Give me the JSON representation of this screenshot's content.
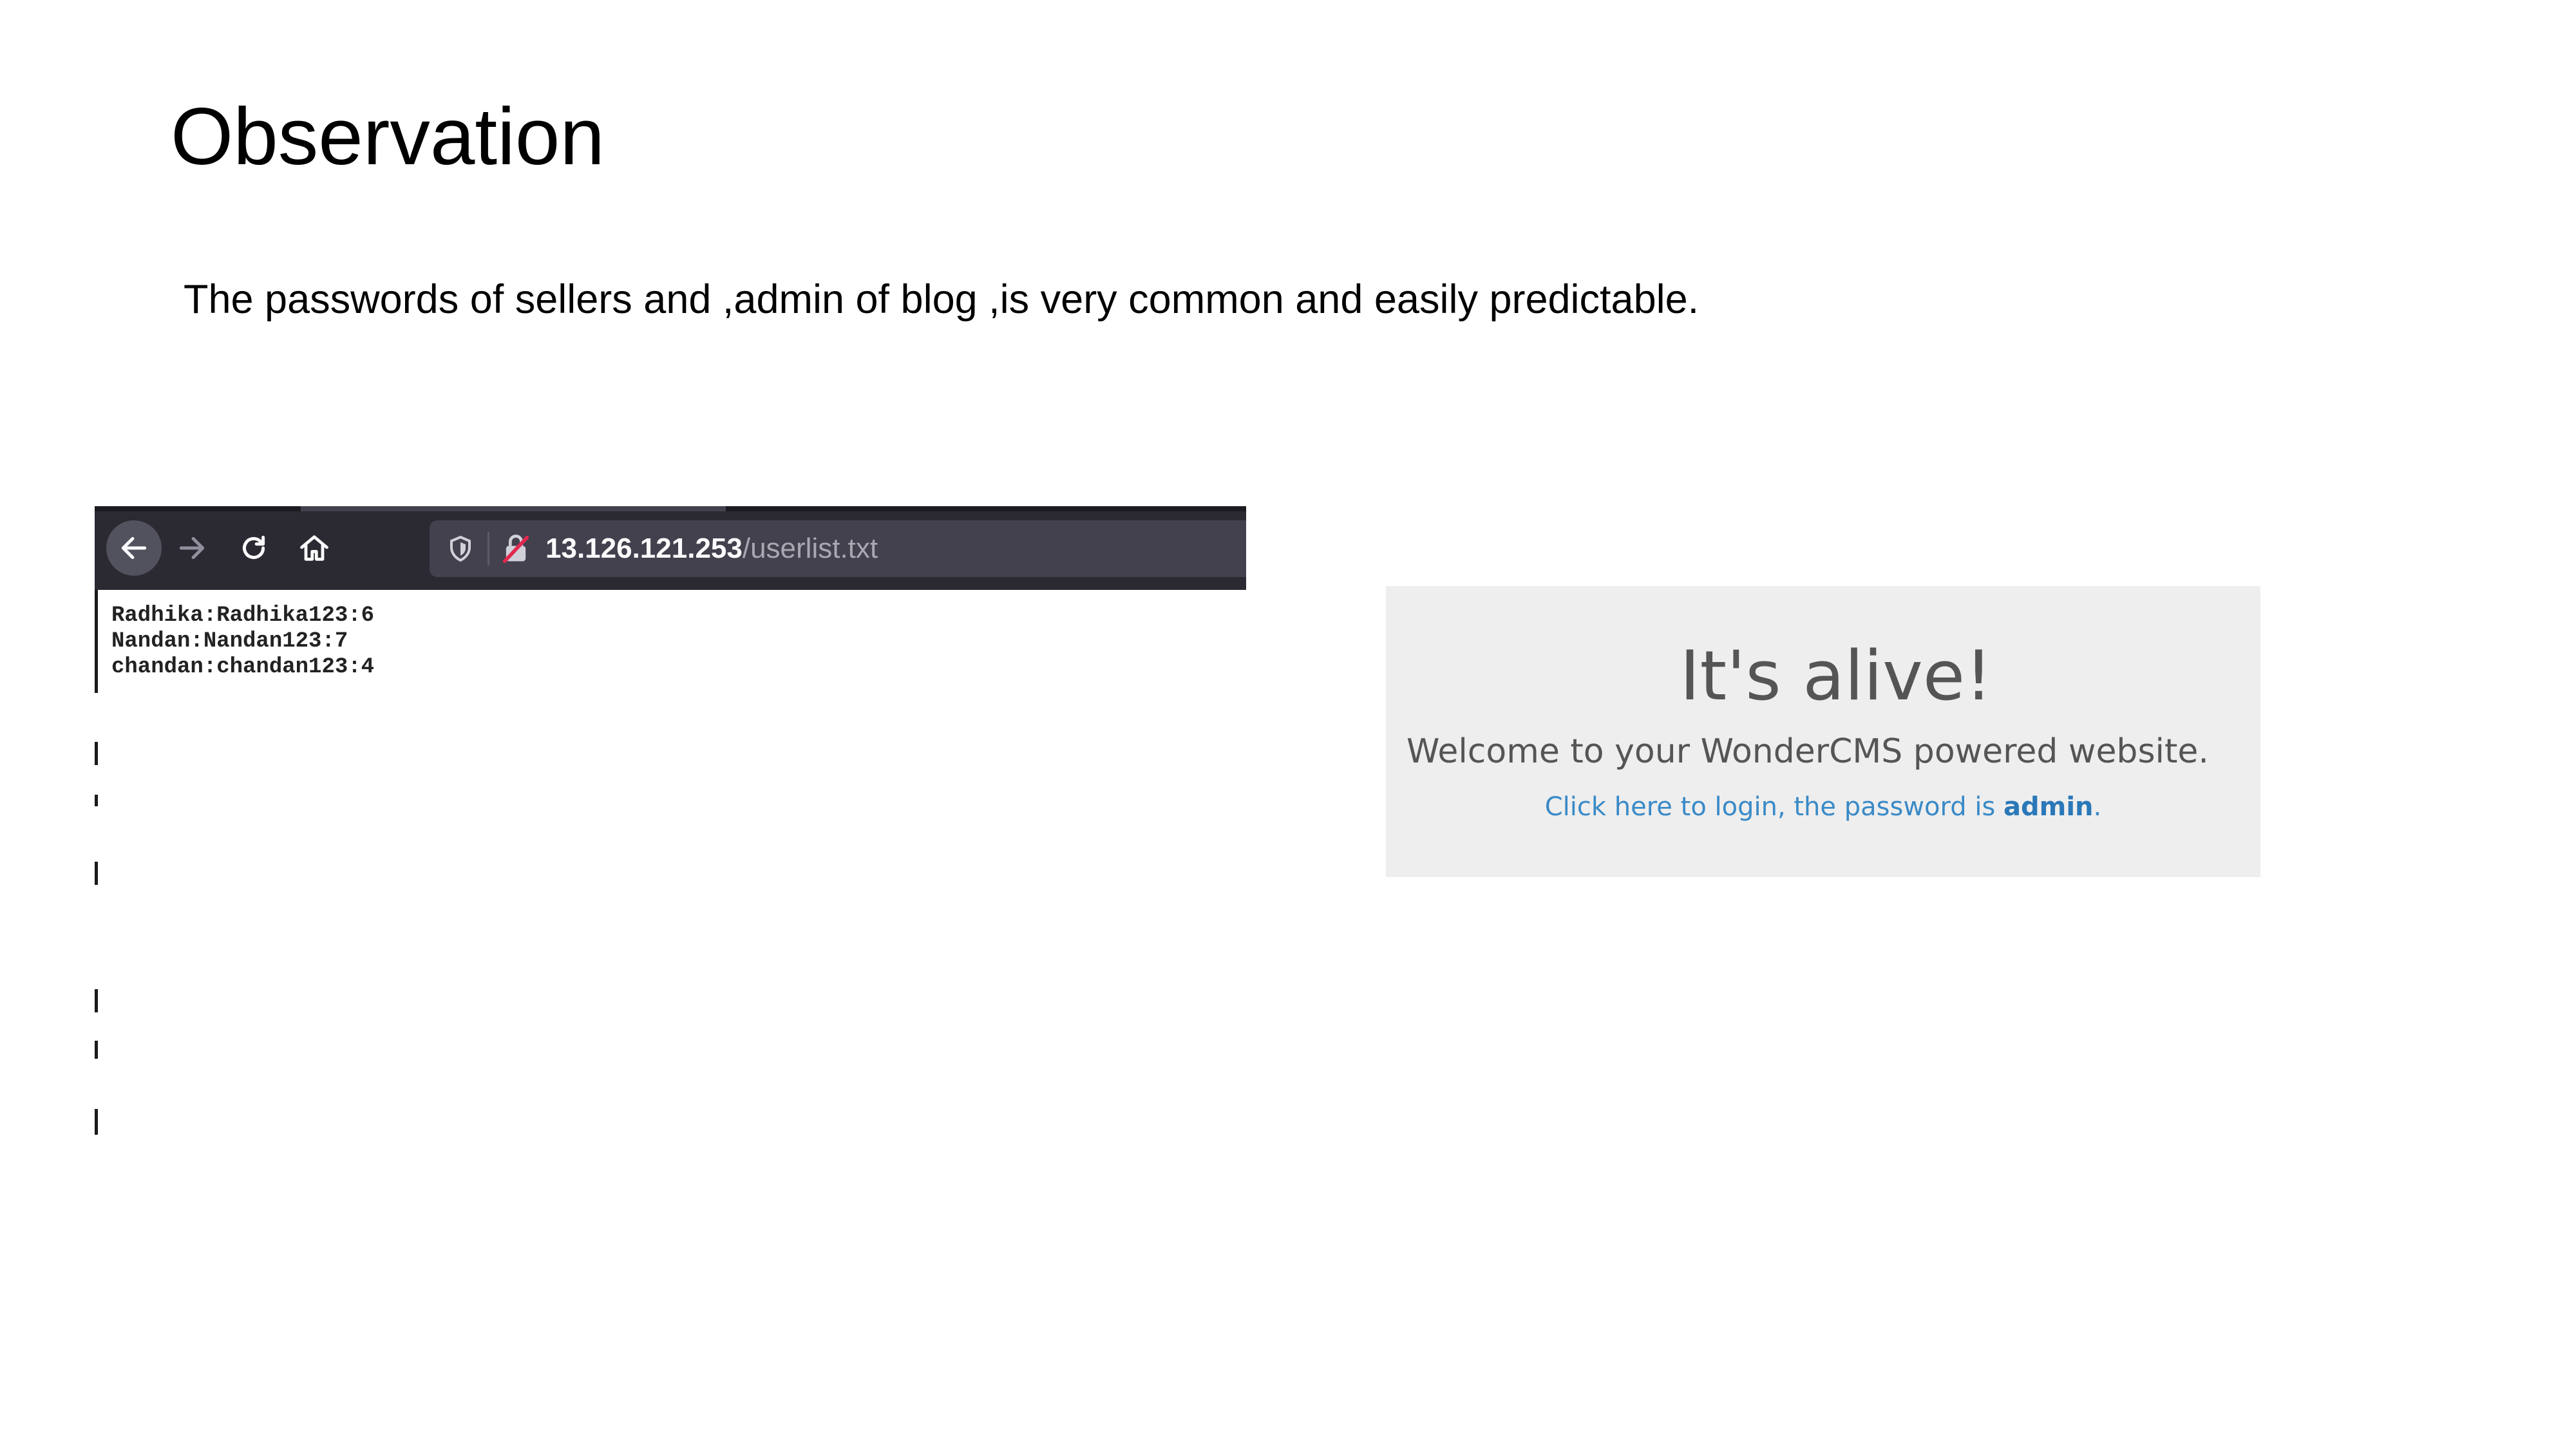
{
  "slide": {
    "title": "Observation",
    "body": "The passwords of sellers and ,admin of blog ,is very common and easily predictable."
  },
  "browser": {
    "url_host": "13.126.121.253",
    "url_path": "/userlist.txt",
    "icons": {
      "back": "back-arrow-icon",
      "forward": "forward-arrow-icon",
      "reload": "reload-icon",
      "home": "home-icon",
      "tracking": "tracking-shield-icon",
      "insecure": "insecure-lock-icon"
    },
    "file_lines": [
      "Radhika:Radhika123:6",
      "Nandan:Nandan123:7",
      "chandan:chandan123:4"
    ]
  },
  "cms": {
    "heading": "It's alive!",
    "welcome": "Welcome to your WonderCMS powered website.",
    "login_text": "Click here to login, the password is ",
    "password": "admin",
    "login_suffix": ".",
    "colors": {
      "panel_bg": "#eeeeee",
      "link": "#3a8ac7"
    }
  }
}
